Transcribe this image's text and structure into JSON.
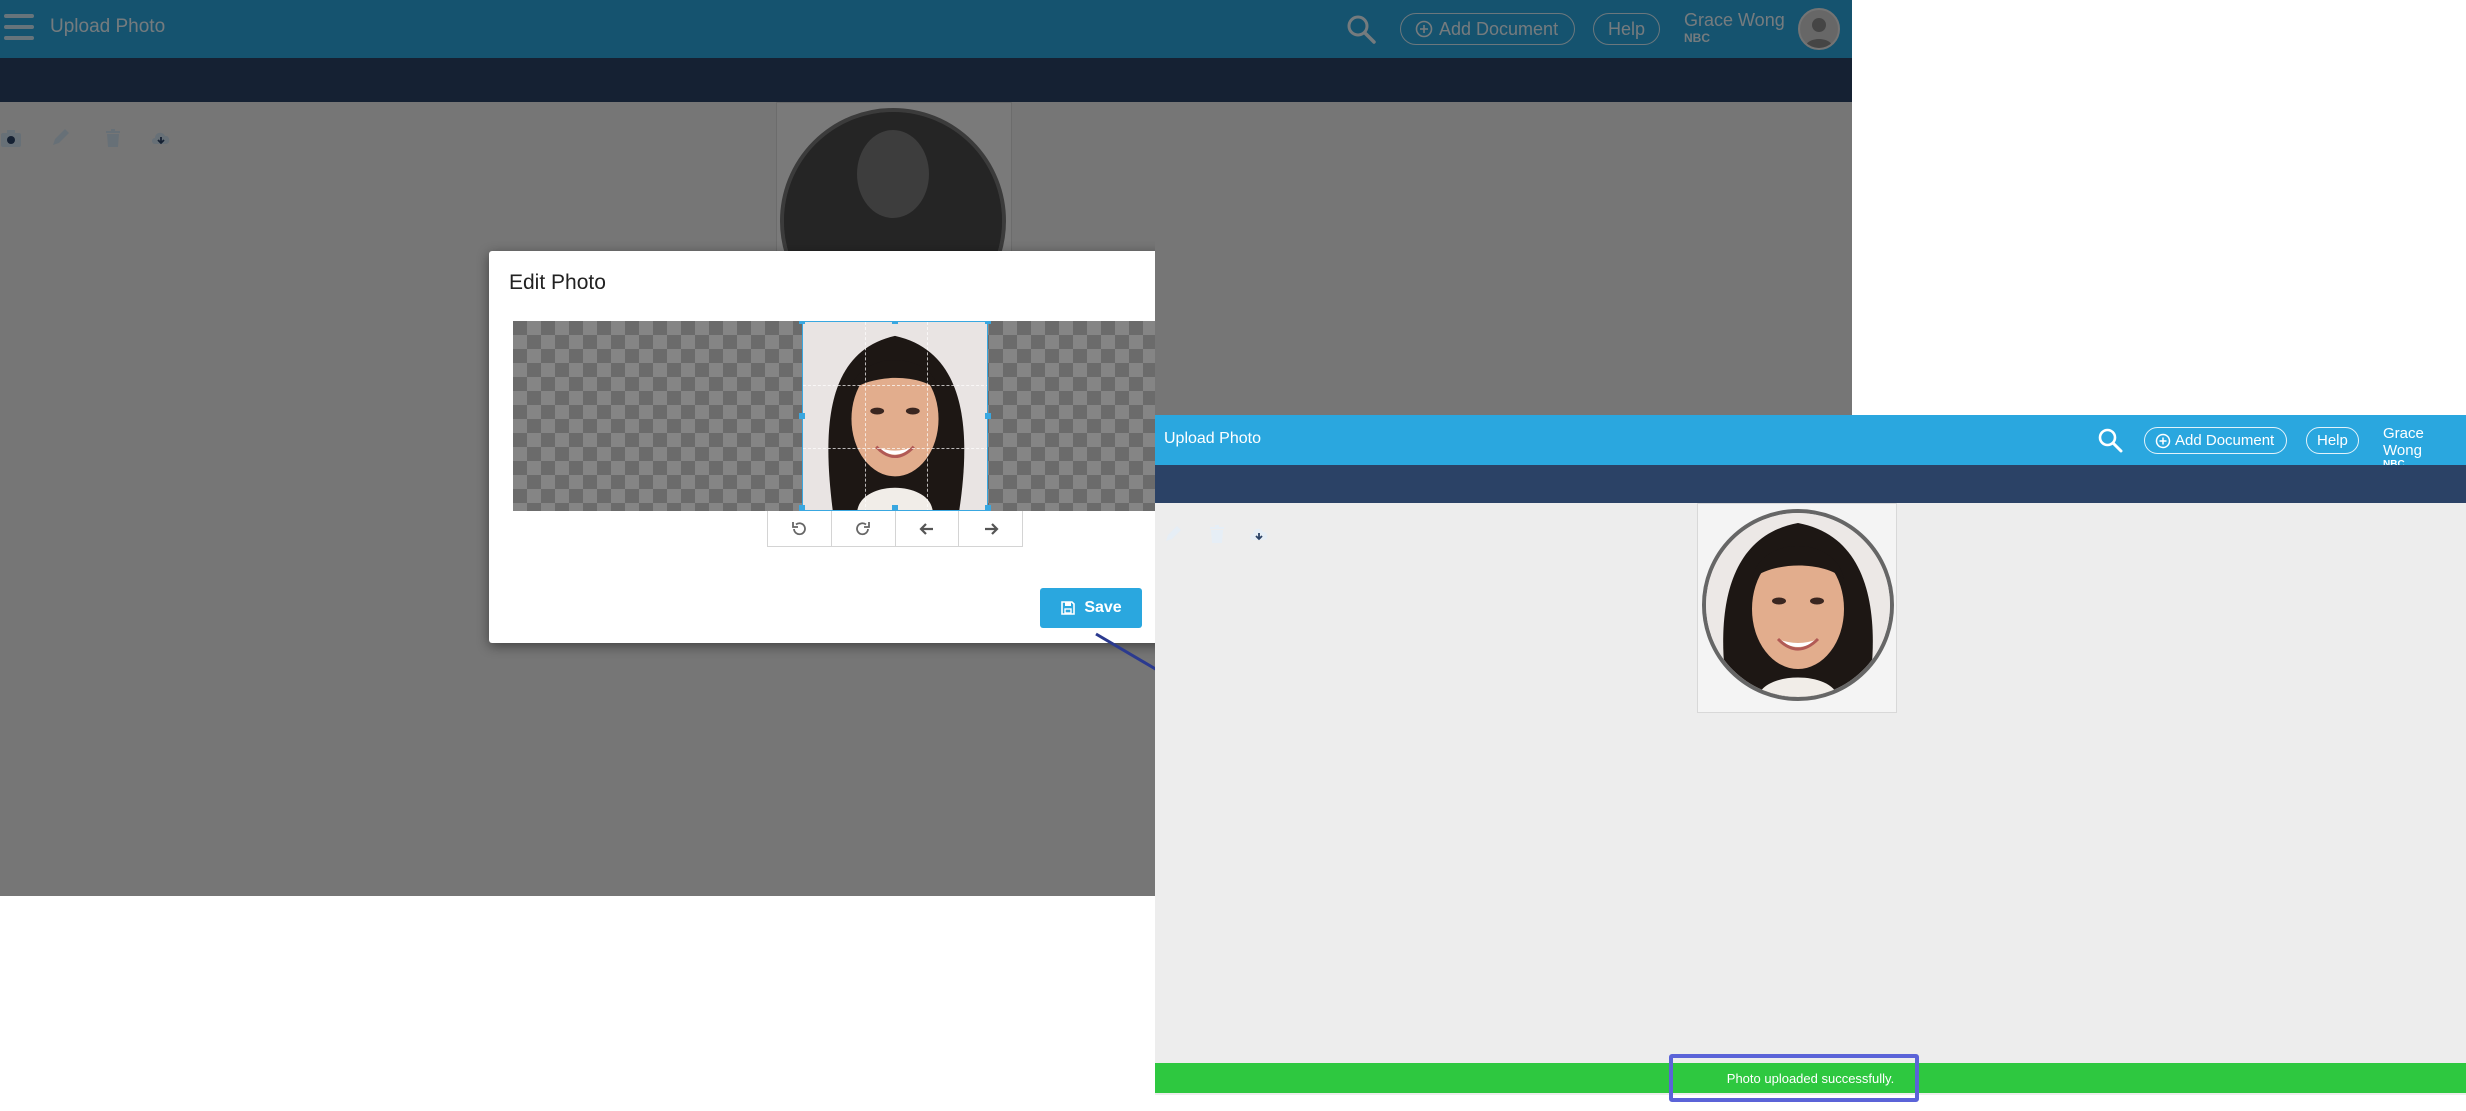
{
  "left_app": {
    "title": "Upload Photo",
    "add_document_label": "Add Document",
    "help_label": "Help",
    "user_name": "Grace Wong",
    "user_org": "NBC"
  },
  "modal": {
    "title": "Edit Photo",
    "close_symbol": "✖",
    "save_label": "Save",
    "controls": [
      "rotate-left-icon",
      "rotate-right-icon",
      "arrow-left-icon",
      "arrow-right-icon"
    ]
  },
  "right_app": {
    "title": "Upload Photo",
    "add_document_label": "Add Document",
    "help_label": "Help",
    "user_name": "Grace Wong",
    "user_org": "NBC",
    "status_message": "Photo uploaded successfully."
  },
  "colors": {
    "header": "#2aa7df",
    "toolbar": "#2b4266",
    "success": "#2ec840",
    "highlight": "#5b63d8",
    "arrow": "#2b3a8f"
  }
}
